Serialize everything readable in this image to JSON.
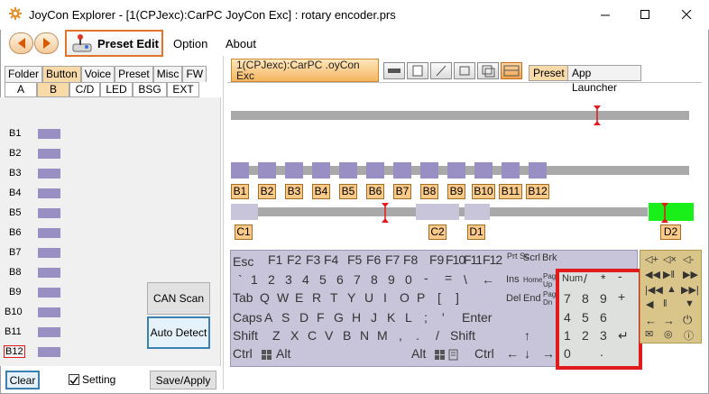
{
  "window": {
    "title": "JoyCon Explorer - [1(CPJexc):CarPC JoyCon Exc] : rotary encoder.prs",
    "icon": "gear-icon",
    "controls": [
      "minimize-icon",
      "maximize-icon",
      "close-icon"
    ]
  },
  "toolbar": {
    "back_icon": "back-arrow-icon",
    "forward_icon": "forward-arrow-icon",
    "preset_edit_label": "Preset Edit",
    "menu": [
      "Option",
      "About"
    ]
  },
  "left": {
    "tabs": [
      {
        "label": "Folder",
        "active": false
      },
      {
        "label": "Button",
        "active": true
      },
      {
        "label": "Voice",
        "active": false
      },
      {
        "label": "Preset",
        "active": false
      },
      {
        "label": "Misc",
        "active": false
      },
      {
        "label": "FW",
        "active": false
      }
    ],
    "subtabs": [
      {
        "label": "A",
        "active": false
      },
      {
        "label": "B",
        "active": true
      },
      {
        "label": "C/D",
        "active": false
      },
      {
        "label": "LED",
        "active": false
      },
      {
        "label": "BSG",
        "active": false
      },
      {
        "label": "EXT",
        "active": false
      }
    ],
    "buttons": [
      "B1",
      "B2",
      "B3",
      "B4",
      "B5",
      "B6",
      "B7",
      "B8",
      "B9",
      "B10",
      "B11",
      "B12"
    ],
    "can_scan_label": "CAN Scan",
    "auto_detect_label": "Auto Detect",
    "clear_label": "Clear",
    "setting_label": "Setting",
    "setting_checked": true,
    "save_apply_label": "Save/Apply"
  },
  "right": {
    "doc_tab": {
      "line1": "1(CPJexc):CarPC .oyCon Exc",
      "line2": "rotary encoder"
    },
    "tabs": [
      {
        "label": "Preset",
        "active": true
      },
      {
        "label": "App Launcher",
        "active": false
      }
    ],
    "b_labels": [
      "B1",
      "B2",
      "B3",
      "B4",
      "B5",
      "B6",
      "B7",
      "B8",
      "B9",
      "B10",
      "B11",
      "B12"
    ],
    "cd_labels": [
      "C1",
      "C2",
      "D1",
      "D2"
    ]
  },
  "keyboard": {
    "row1": [
      "Esc",
      "F1",
      "F2",
      "F3",
      "F4",
      "F5",
      "F6",
      "F7",
      "F8",
      "F9",
      "F10",
      "F11",
      "F12"
    ],
    "row1_small": [
      "Prt Sc",
      "Scrl",
      "Brk"
    ],
    "row2": [
      "`",
      "1",
      "2",
      "3",
      "4",
      "5",
      "6",
      "7",
      "8",
      "9",
      "0",
      "-",
      "=",
      "\\",
      "←"
    ],
    "row3": [
      "Tab",
      "Q",
      "W",
      "E",
      "R",
      "T",
      "Y",
      "U",
      "I",
      "O",
      "P",
      "[",
      "]"
    ],
    "row4": [
      "Caps",
      "A",
      "S",
      "D",
      "F",
      "G",
      "H",
      "J",
      "K",
      "L",
      ";",
      "'",
      "Enter"
    ],
    "row5": [
      "Shift",
      "Z",
      "X",
      "C",
      "V",
      "B",
      "N",
      "M",
      ",",
      ".",
      "/",
      "Shift"
    ],
    "row6": [
      "Ctrl",
      "Alt",
      "Alt",
      "Ctrl"
    ],
    "nav1": [
      "Ins",
      "Home",
      "Page Up"
    ],
    "nav2": [
      "Del",
      "End",
      "Page Dn"
    ],
    "arrows": [
      "↑",
      "←",
      "↓",
      "→"
    ],
    "numpad": [
      "Num",
      "/",
      "*",
      "-",
      "7",
      "8",
      "9",
      "+",
      "4",
      "5",
      "6",
      "1",
      "2",
      "3",
      "↵",
      "0",
      "."
    ]
  },
  "colors": {
    "accent": "#f4b561",
    "swatch": "#9a8fc2",
    "marker": "#e01b1b",
    "active_green": "#19f019",
    "highlight": "#e01b1b"
  }
}
